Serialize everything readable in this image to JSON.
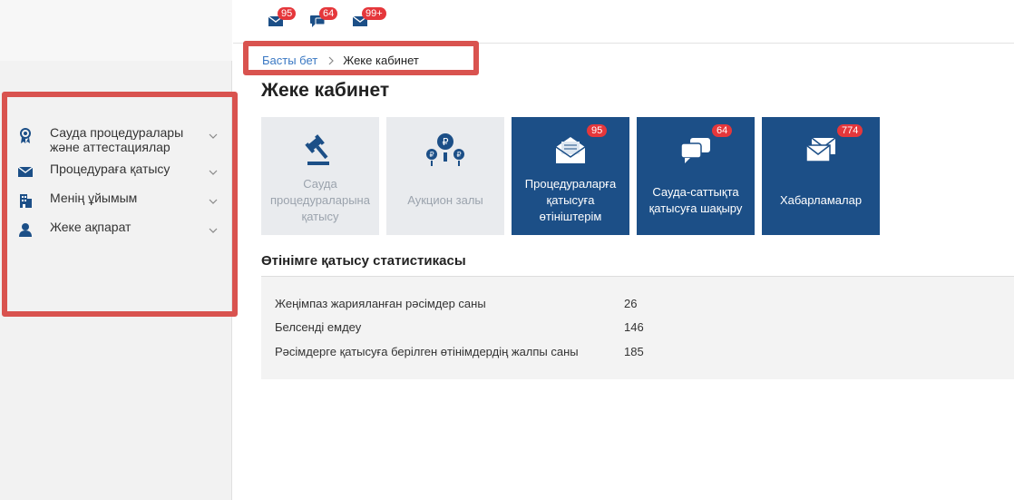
{
  "topbar": {
    "notifications": [
      {
        "icon": "envelope-icon",
        "count": "95"
      },
      {
        "icon": "chat-icon",
        "count": "64"
      },
      {
        "icon": "envelope-icon",
        "count": "99+"
      }
    ]
  },
  "sidebar": {
    "items": [
      {
        "icon": "award-icon",
        "label": "Сауда процедуралары және аттестациялар"
      },
      {
        "icon": "envelope-icon",
        "label": "Процедураға қатысу"
      },
      {
        "icon": "building-icon",
        "label": "Менің ұйымым"
      },
      {
        "icon": "user-icon",
        "label": "Жеке ақпарат"
      }
    ]
  },
  "breadcrumb": {
    "home": "Басты бет",
    "current": "Жеке кабинет"
  },
  "page": {
    "title": "Жеке кабинет"
  },
  "tiles": [
    {
      "label": "Сауда процедураларына қатысу",
      "icon": "gavel-icon",
      "style": "light",
      "badge": ""
    },
    {
      "label": "Аукцион залы",
      "icon": "ruble-coins-icon",
      "style": "light",
      "badge": ""
    },
    {
      "label": "Процедураларға қатысуға өтініштерім",
      "icon": "open-envelope-icon",
      "style": "dark",
      "badge": "95"
    },
    {
      "label": "Сауда-саттықта қатысуға шақыру",
      "icon": "chat-bubbles-icon",
      "style": "dark",
      "badge": "64"
    },
    {
      "label": "Хабарламалар",
      "icon": "envelopes-icon",
      "style": "dark",
      "badge": "774"
    }
  ],
  "stats": {
    "title": "Өтінімге қатысу статистикасы",
    "rows": [
      {
        "label": "Жеңімпаз жарияланған рәсімдер саны",
        "value": "26"
      },
      {
        "label": "Белсенді емдеу",
        "value": "146"
      },
      {
        "label": "Рәсімдерге қатысуға берілген өтінімдердің жалпы саны",
        "value": "185"
      }
    ]
  },
  "colors": {
    "accent_dark": "#1c4f87",
    "tile_light": "#e9ebee",
    "badge": "#e5373b",
    "highlight_frame": "#d9534f",
    "link": "#3a78c3"
  }
}
